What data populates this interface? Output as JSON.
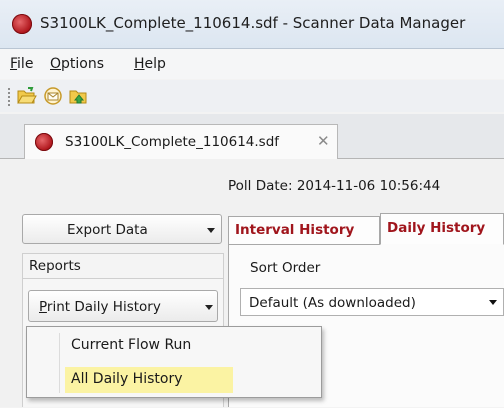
{
  "window": {
    "title": "S3100LK_Complete_110614.sdf - Scanner Data Manager"
  },
  "menubar": {
    "items": [
      {
        "label_u": "F",
        "label_rest": "ile"
      },
      {
        "label_u": "O",
        "label_rest": "ptions"
      },
      {
        "label_u": "H",
        "label_rest": "elp"
      }
    ]
  },
  "toolbar": {
    "icons": [
      "open-folder-icon",
      "email-icon",
      "export-folder-icon"
    ]
  },
  "document_tab": {
    "label": "S3100LK_Complete_110614.sdf",
    "close": "✕"
  },
  "poll_date": "Poll Date: 2014-11-06 10:56:44",
  "export_button": {
    "label": "Export Data"
  },
  "reports": {
    "header": "Reports",
    "print_button": {
      "label_u": "P",
      "label_rest": "rint Daily History"
    }
  },
  "tabs": [
    {
      "label": "Interval History"
    },
    {
      "label": "Daily History"
    }
  ],
  "sort_order": {
    "label": "Sort Order",
    "selected": "Default (As downloaded)"
  },
  "popup_menu": {
    "items": [
      {
        "label": "Current Flow Run",
        "highlighted": false
      },
      {
        "label": "All Daily History",
        "highlighted": true
      }
    ]
  },
  "colors": {
    "brand_red": "#a0151c",
    "highlight": "#fbf3a3"
  }
}
